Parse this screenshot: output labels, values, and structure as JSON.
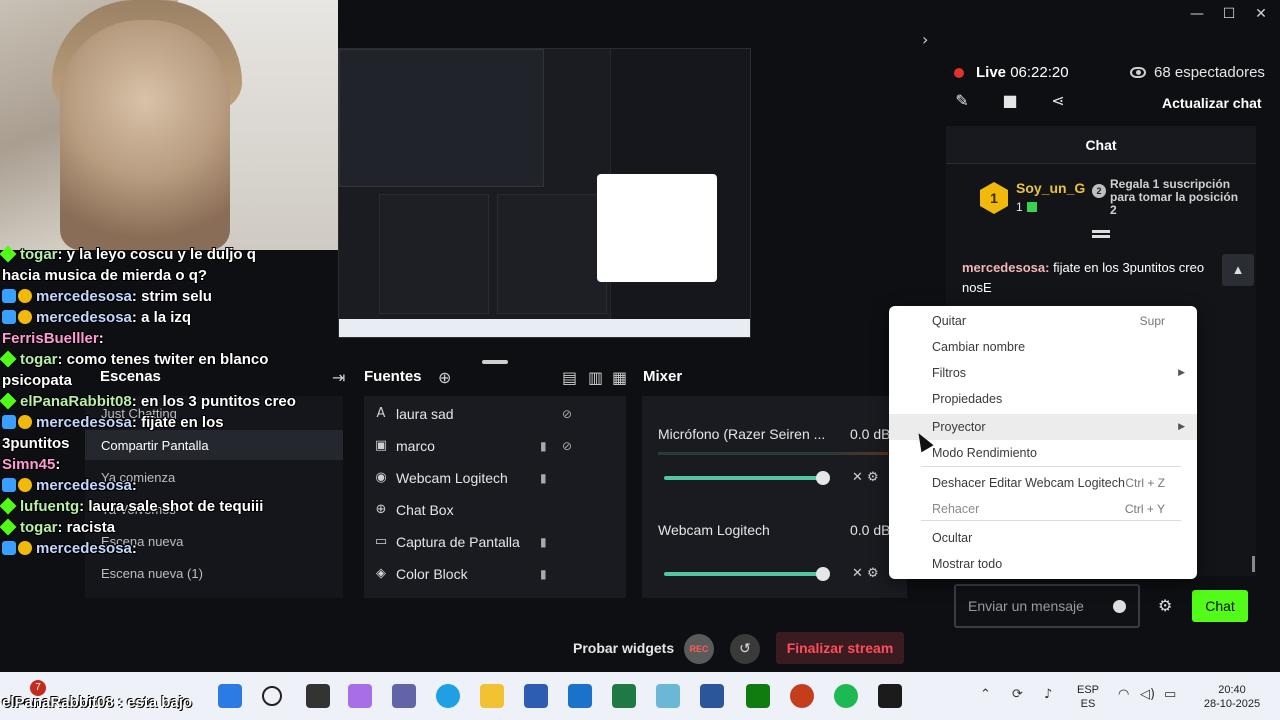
{
  "window": {
    "minimize": "—",
    "maximize": "☐",
    "close": "✕"
  },
  "stream": {
    "live_label": "Live",
    "live_time": "06:22:20",
    "viewers": "68 espectadores",
    "update_chat": "Actualizar chat"
  },
  "chat": {
    "title": "Chat",
    "sub_card": {
      "badge": "1",
      "user": "Soy_un_G",
      "count": "1",
      "rank": "2",
      "desc": "Regala 1 suscripción para tomar la posición 2"
    },
    "pinned": {
      "user": "mercedesosa:",
      "text": " fijate en los 3puntitos creo nosE"
    },
    "input_placeholder": "Enviar un mensaje",
    "send_label": "Chat"
  },
  "overlay_chat": [
    {
      "user": "togar",
      "text": ": y la leyo coscu y le duljo q",
      "style": "u"
    },
    {
      "user": "",
      "text": "hacia musica de mierda o q?",
      "style": ""
    },
    {
      "user": "mercedesosa",
      "text": ": strim selu",
      "style": "u2"
    },
    {
      "user": "mercedesosa",
      "text": ": a la izq",
      "style": "u2"
    },
    {
      "user": "FerrisBuelller",
      "text": ":",
      "style": "u3"
    },
    {
      "user": "togar",
      "text": ": como tenes twiter en blanco",
      "style": "u"
    },
    {
      "user": "",
      "text": "psicopata",
      "style": ""
    },
    {
      "user": "elPanaRabbit08",
      "text": ": en los 3 puntitos creo",
      "style": "u"
    },
    {
      "user": "mercedesosa",
      "text": ": fijate en los",
      "style": "u2"
    },
    {
      "user": "",
      "text": "3puntitos",
      "style": ""
    },
    {
      "user": "Simn45",
      "text": ":",
      "style": "u3"
    },
    {
      "user": "mercedesosa",
      "text": ":",
      "style": "u2"
    },
    {
      "user": "lufuentg",
      "text": ": laura sale shot de tequiii",
      "style": "u"
    },
    {
      "user": "togar",
      "text": ": racista",
      "style": "u"
    },
    {
      "user": "mercedesosa",
      "text": ":",
      "style": "u2"
    }
  ],
  "overlay_bottom": "elPanaRabbit08 : esta bajo",
  "scenes": {
    "header": "Escenas",
    "items": [
      "Just Chatting",
      "Compartir Pantalla",
      "Ya comienza",
      "Ya Volvemos",
      "Escena nueva",
      "Escena nueva (1)"
    ]
  },
  "sources": {
    "header": "Fuentes",
    "items": [
      {
        "name": "laura sad",
        "icon": "A",
        "lock": false,
        "hidden": true
      },
      {
        "name": "marco",
        "icon": "▣",
        "lock": true,
        "hidden": true
      },
      {
        "name": "Webcam Logitech",
        "icon": "◉",
        "lock": true,
        "hidden": false
      },
      {
        "name": "Chat Box",
        "icon": "⊕",
        "lock": false,
        "hidden": false
      },
      {
        "name": "Captura de Pantalla",
        "icon": "▭",
        "lock": true,
        "hidden": false
      },
      {
        "name": "Color Block",
        "icon": "◈",
        "lock": true,
        "hidden": false
      }
    ]
  },
  "mixer": {
    "header": "Mixer",
    "channels": [
      {
        "name": "Micrófono (Razer Seiren ...",
        "db": "0.0 dB"
      },
      {
        "name": "Webcam Logitech",
        "db": "0.0 dB"
      }
    ]
  },
  "footer": {
    "test_widgets": "Probar widgets",
    "rec": "REC",
    "end_stream": "Finalizar stream"
  },
  "context_menu": [
    {
      "label": "Quitar",
      "shortcut": "Supr",
      "submenu": false,
      "disabled": false
    },
    {
      "label": "Cambiar nombre",
      "shortcut": "",
      "submenu": false,
      "disabled": false
    },
    {
      "label": "Filtros",
      "shortcut": "",
      "submenu": true,
      "disabled": false
    },
    {
      "label": "Propiedades",
      "shortcut": "",
      "submenu": false,
      "disabled": false
    },
    {
      "label": "Proyector",
      "shortcut": "",
      "submenu": true,
      "disabled": false
    },
    {
      "label": "Modo Rendimiento",
      "shortcut": "",
      "submenu": false,
      "disabled": false
    },
    {
      "label": "Deshacer Editar Webcam Logitech",
      "shortcut": "Ctrl + Z",
      "submenu": false,
      "disabled": false
    },
    {
      "label": "Rehacer",
      "shortcut": "Ctrl + Y",
      "submenu": false,
      "disabled": true
    },
    {
      "label": "Ocultar",
      "shortcut": "",
      "submenu": false,
      "disabled": false
    },
    {
      "label": "Mostrar todo",
      "shortcut": "",
      "submenu": false,
      "disabled": false
    }
  ],
  "taskbar": {
    "notification_count": "7",
    "language": "ESP",
    "layout": "ES",
    "time": "20:40",
    "date": "28-10-2025"
  },
  "colors": {
    "accent": "#53fc18",
    "live": "#e0312b",
    "end_stream": "#ff4d5a"
  }
}
